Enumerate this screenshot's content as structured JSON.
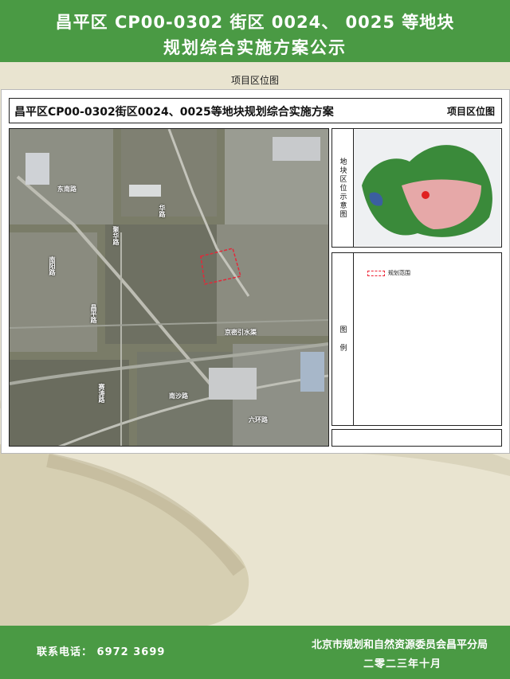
{
  "header": {
    "title_line1": "昌平区 CP00-0302 街区 0024、 0025 等地块",
    "title_line2": "规划综合实施方案公示"
  },
  "caption": "项目区位图",
  "panel": {
    "title": "昌平区CP00-0302街区0024、0025等地块规划综合实施方案",
    "subtitle": "项目区位图"
  },
  "side": {
    "map_label": "地块区位示意图",
    "legend_label": "图    例",
    "legend_item": "规划范围"
  },
  "roads": [
    {
      "label": "东南路"
    },
    {
      "label": "华路"
    },
    {
      "label": "聚华路"
    },
    {
      "label": "南阳路"
    },
    {
      "label": "昌平路"
    },
    {
      "label": "京密引水渠"
    },
    {
      "label": "赛涛路"
    },
    {
      "label": "南沙路"
    },
    {
      "label": "六环路"
    }
  ],
  "footer": {
    "phone_label": "联系电话：",
    "phone": "6972 3699",
    "org": "北京市规划和自然资源委员会昌平分局",
    "date": "二零二三年十月"
  },
  "colors": {
    "header_green": "#4a9a44",
    "plan_boundary": "#e02a3a"
  }
}
